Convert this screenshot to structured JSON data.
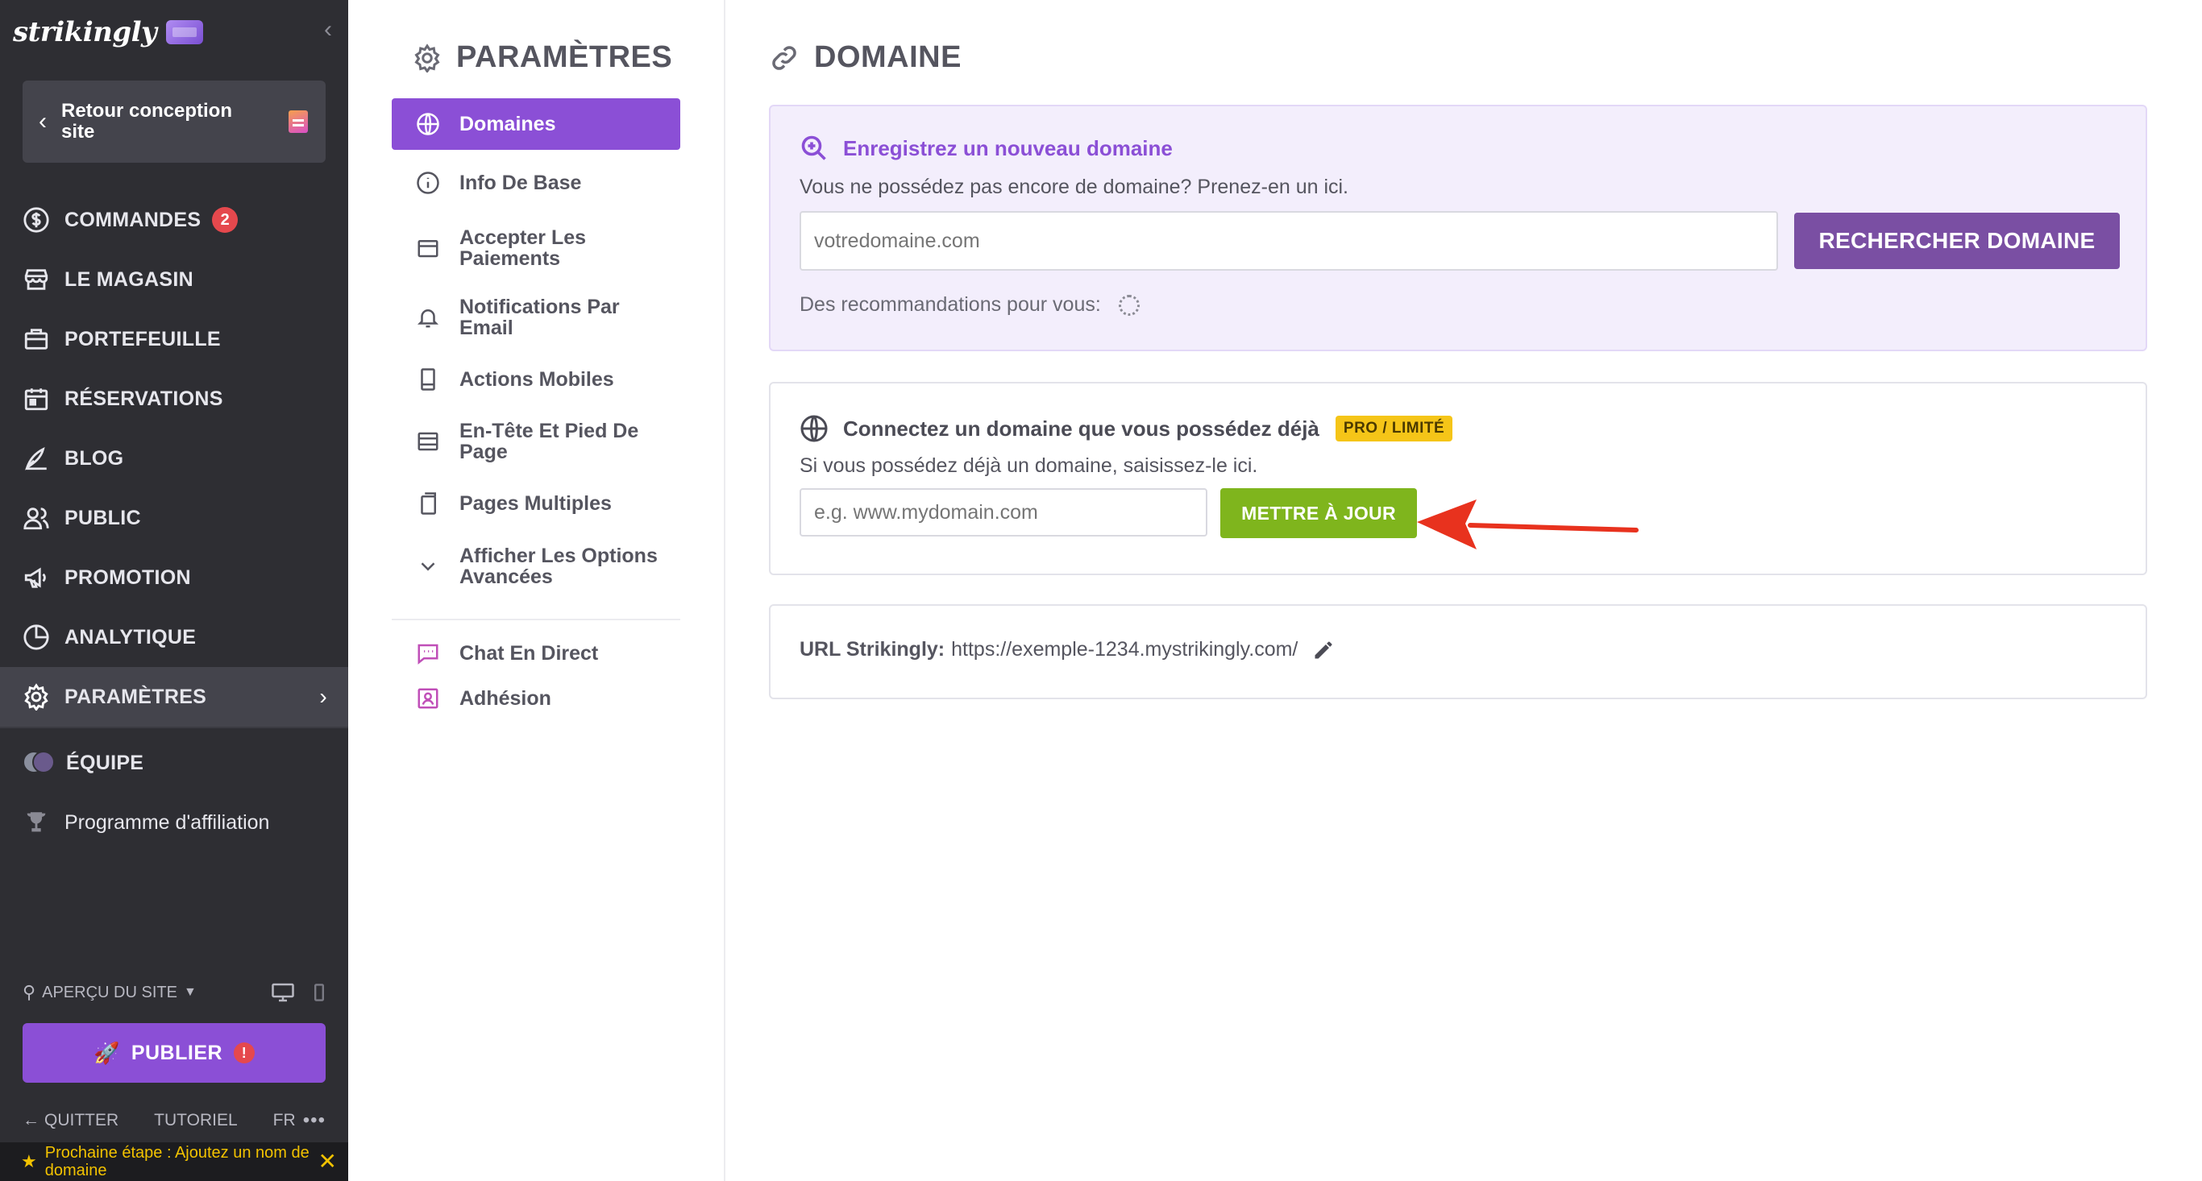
{
  "sidebar": {
    "logo": "strikingly",
    "back_label": "Retour conception site",
    "items": [
      {
        "label": "COMMANDES",
        "icon": "dollar-circle-icon",
        "badge": "2"
      },
      {
        "label": "LE MAGASIN",
        "icon": "store-icon"
      },
      {
        "label": "PORTEFEUILLE",
        "icon": "briefcase-icon"
      },
      {
        "label": "RÉSERVATIONS",
        "icon": "calendar-icon"
      },
      {
        "label": "BLOG",
        "icon": "pen-icon"
      },
      {
        "label": "PUBLIC",
        "icon": "people-icon"
      },
      {
        "label": "PROMOTION",
        "icon": "megaphone-icon"
      },
      {
        "label": "ANALYTIQUE",
        "icon": "pie-chart-icon"
      },
      {
        "label": "PARAMÈTRES",
        "icon": "gear-icon",
        "active": true
      }
    ],
    "team_label": "ÉQUIPE",
    "affiliate_label": "Programme d'affiliation",
    "preview_label": "APERÇU DU SITE",
    "publish_label": "PUBLIER",
    "publish_warning": "!",
    "footer": {
      "quit": "QUITTER",
      "tutorial": "TUTORIEL",
      "lang": "FR",
      "more": "•••"
    },
    "next_step": "Prochaine étape : Ajoutez un nom de domaine"
  },
  "settings": {
    "title": "PARAMÈTRES",
    "items": [
      {
        "label": "Domaines",
        "icon": "globe-icon",
        "active": true
      },
      {
        "label": "Info De Base",
        "icon": "info-icon"
      },
      {
        "label": "Accepter Les Paiements",
        "icon": "wallet-icon"
      },
      {
        "label": "Notifications Par Email",
        "icon": "bell-icon"
      },
      {
        "label": "Actions Mobiles",
        "icon": "mobile-icon"
      },
      {
        "label": "En-Tête Et Pied De Page",
        "icon": "layout-icon"
      },
      {
        "label": "Pages Multiples",
        "icon": "pages-icon"
      },
      {
        "label": "Afficher Les Options Avancées",
        "icon": "chevron-down-icon"
      }
    ],
    "extra_items": [
      {
        "label": "Chat En Direct",
        "icon": "chat-icon"
      },
      {
        "label": "Adhésion",
        "icon": "member-icon"
      }
    ]
  },
  "main": {
    "title": "DOMAINE",
    "register": {
      "heading": "Enregistrez un nouveau domaine",
      "subtext": "Vous ne possédez pas encore de domaine? Prenez-en un ici.",
      "placeholder": "votredomaine.com",
      "button": "RECHERCHER DOMAINE",
      "recommendations": "Des recommandations pour vous:"
    },
    "connect": {
      "heading": "Connectez un domaine que vous possédez déjà",
      "badge": "PRO / LIMITÉ",
      "subtext": "Si vous possédez déjà un domaine, saisissez-le ici.",
      "placeholder": "e.g. www.mydomain.com",
      "button": "METTRE À JOUR"
    },
    "url": {
      "label": "URL Strikingly:",
      "value": "https://exemple-1234.mystrikingly.com/"
    }
  },
  "colors": {
    "sidebar_bg": "#2e2e33",
    "accent_purple": "#8b4fd6",
    "search_button": "#7a4fa3",
    "update_button": "#7fb51d",
    "badge_red": "#e5484d",
    "pro_badge": "#f5c518",
    "annotation_arrow": "#e8321e"
  }
}
